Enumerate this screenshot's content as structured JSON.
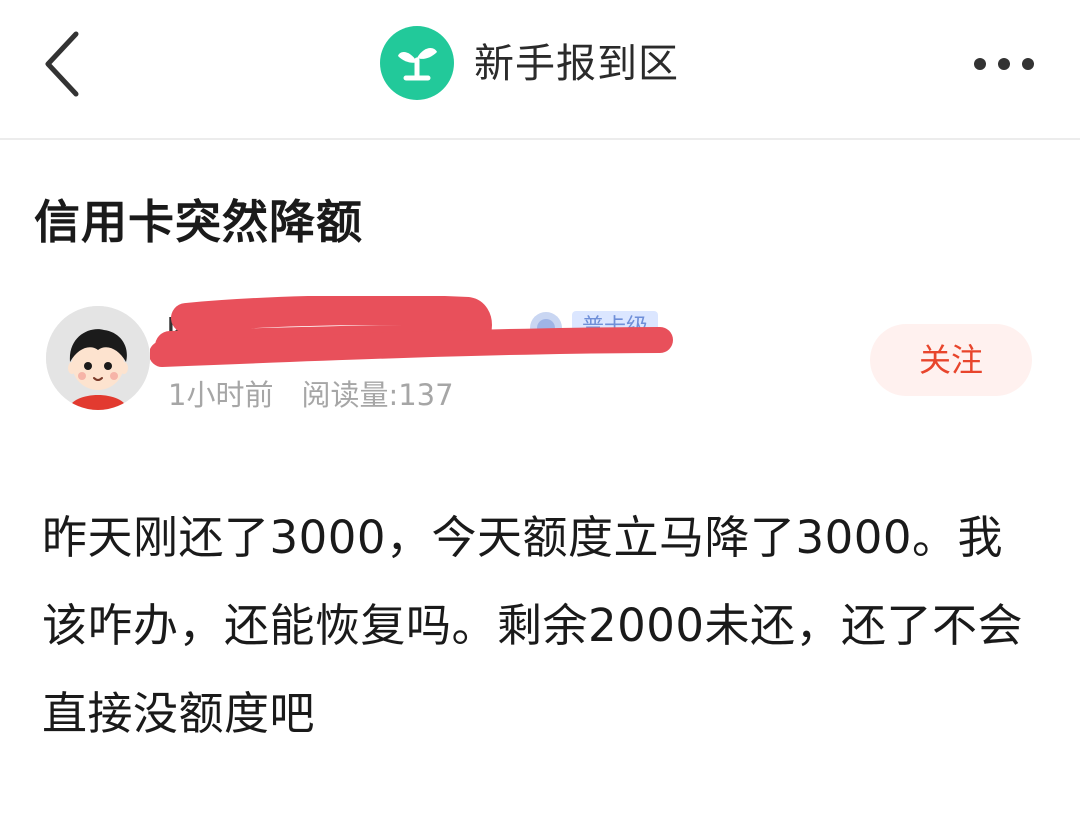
{
  "header": {
    "board_name": "新手报到区",
    "brand_color": "#22c99a"
  },
  "post": {
    "title": "信用卡突然降额",
    "author": {
      "name_visible": "k 3",
      "level_badge": "普卡级",
      "avatar": "cartoon-boy-avatar"
    },
    "time_ago": "1小时前",
    "read_count": "阅读量:137",
    "follow_label": "关注",
    "body": "昨天刚还了3000，今天额度立马降了3000。我该咋办，还能恢复吗。剩余2000未还，还了不会直接没额度吧"
  },
  "icons": {
    "back": "chevron-left-icon",
    "board": "sprout-icon",
    "more": "more-dots-icon",
    "badge": "level-badge-icon"
  },
  "colors": {
    "follow_text": "#e8452c",
    "follow_bg": "#fff1ef",
    "meta_text": "#a6a6a6",
    "redaction": "#e8505b"
  }
}
